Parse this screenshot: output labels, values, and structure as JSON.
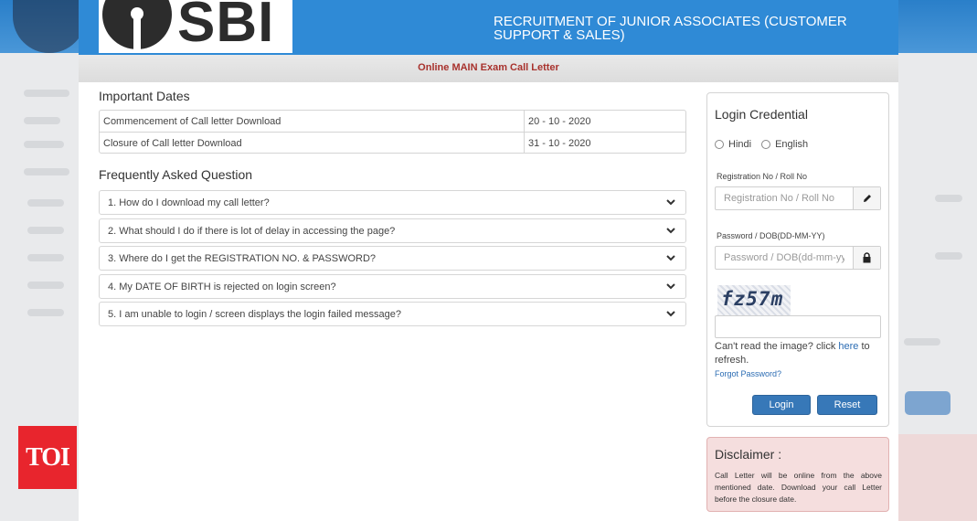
{
  "header": {
    "logo_text": "SBI",
    "title": "RECRUITMENT OF JUNIOR ASSOCIATES (CUSTOMER SUPPORT & SALES)",
    "subtitle": "Online MAIN Exam Call Letter"
  },
  "important_dates": {
    "heading": "Important Dates",
    "rows": [
      {
        "label": "Commencement of Call letter Download",
        "date": "20 - 10 - 2020"
      },
      {
        "label": "Closure of Call letter Download",
        "date": "31 - 10 - 2020"
      }
    ]
  },
  "faq": {
    "heading": "Frequently Asked Question",
    "items": [
      "1. How do I download my call letter?",
      "2. What should I do if there is lot of delay in accessing the page?",
      "3. Where do I get the REGISTRATION NO. & PASSWORD?",
      "4. My DATE OF BIRTH is rejected on login screen?",
      "5. I am unable to login / screen displays the login failed message?"
    ]
  },
  "login": {
    "title": "Login Credential",
    "lang_hindi": "Hindi",
    "lang_english": "English",
    "reg_label": "Registration No / Roll No",
    "reg_placeholder": "Registration No / Roll No",
    "pwd_label": "Password / DOB(DD-MM-YY)",
    "pwd_placeholder": "Password / DOB(dd-mm-yy)",
    "captcha_text": "fz57m",
    "refresh_prefix": "Can't read the image? click ",
    "refresh_link": "here",
    "refresh_suffix": " to refresh.",
    "forgot": "Forgot Password?",
    "login_btn": "Login",
    "reset_btn": "Reset",
    "icons": {
      "reg": "pencil-icon",
      "pwd": "lock-icon"
    }
  },
  "disclaimer": {
    "title": "Disclaimer :",
    "text": "Call Letter will be online from the above mentioned date. Download your call Letter before the closure date."
  },
  "watermark": "TOI",
  "colors": {
    "header_blue": "#2f8ad6",
    "accent_red": "#a8322d",
    "button_blue": "#3778b8",
    "disclaimer_bg": "#f5dede",
    "toi_red": "#e8252d"
  }
}
